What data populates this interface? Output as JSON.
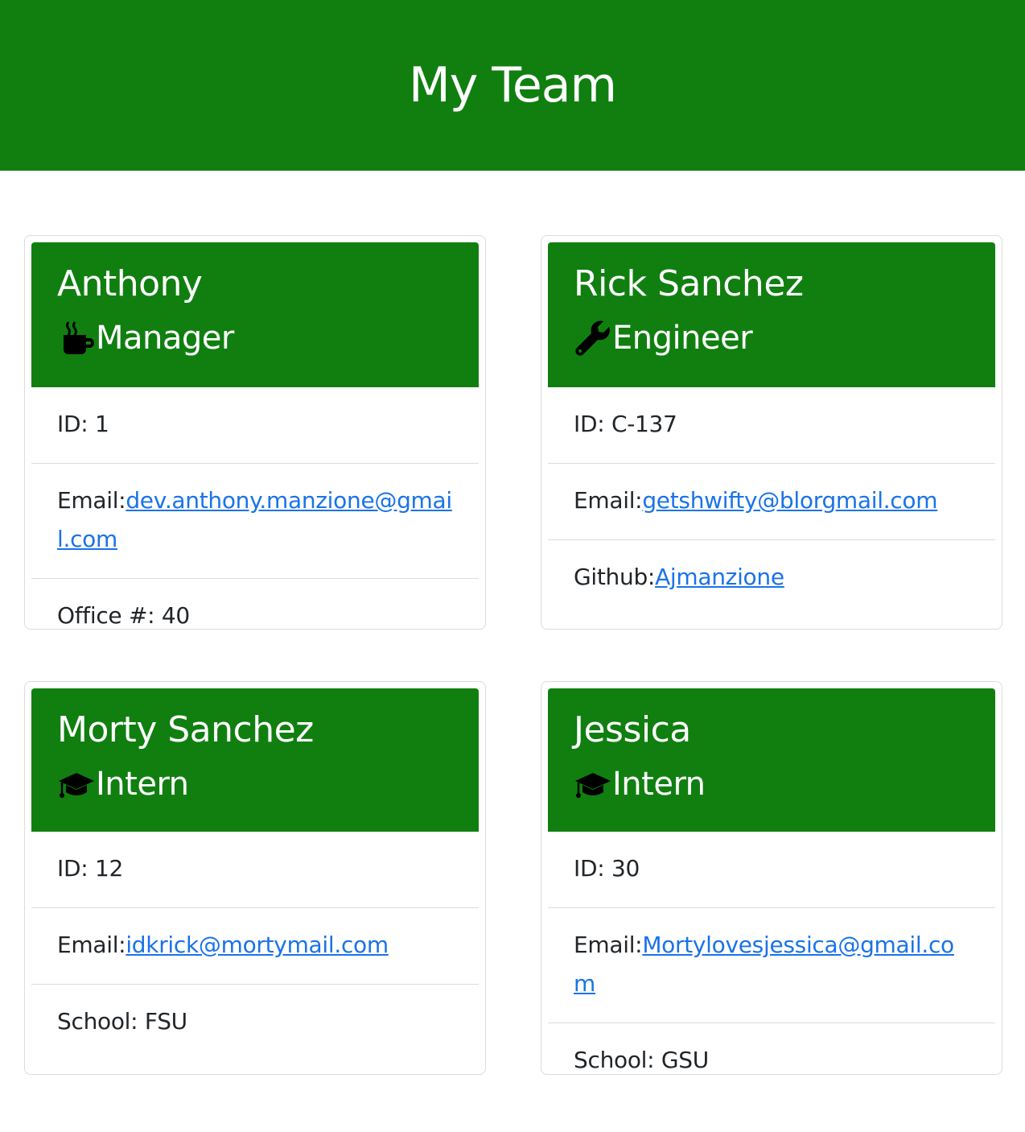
{
  "header": {
    "title": "My Team"
  },
  "cards": [
    {
      "name": "Anthony",
      "role": "Manager",
      "role_icon": "coffee-icon",
      "id_label": "ID: 1",
      "email_label": "Email:",
      "email": "dev.anthony.manzione@gmail.com",
      "extra_label": "Office #: 40"
    },
    {
      "name": "Rick Sanchez",
      "role": "Engineer",
      "role_icon": "wrench-icon",
      "id_label": "ID: C-137",
      "email_label": "Email:",
      "email": "getshwifty@blorgmail.com",
      "github_label": "Github:",
      "github": "Ajmanzione"
    },
    {
      "name": "Morty Sanchez",
      "role": "Intern",
      "role_icon": "graduation-cap-icon",
      "id_label": "ID: 12",
      "email_label": "Email:",
      "email": "idkrick@mortymail.com",
      "extra_label": "School: FSU"
    },
    {
      "name": "Jessica",
      "role": "Intern",
      "role_icon": "graduation-cap-icon",
      "id_label": "ID: 30",
      "email_label": "Email:",
      "email": "Mortylovesjessica@gmail.com",
      "extra_label": "School: GSU"
    }
  ],
  "colors": {
    "header_bg": "#107f10",
    "link": "#1a73e8"
  }
}
